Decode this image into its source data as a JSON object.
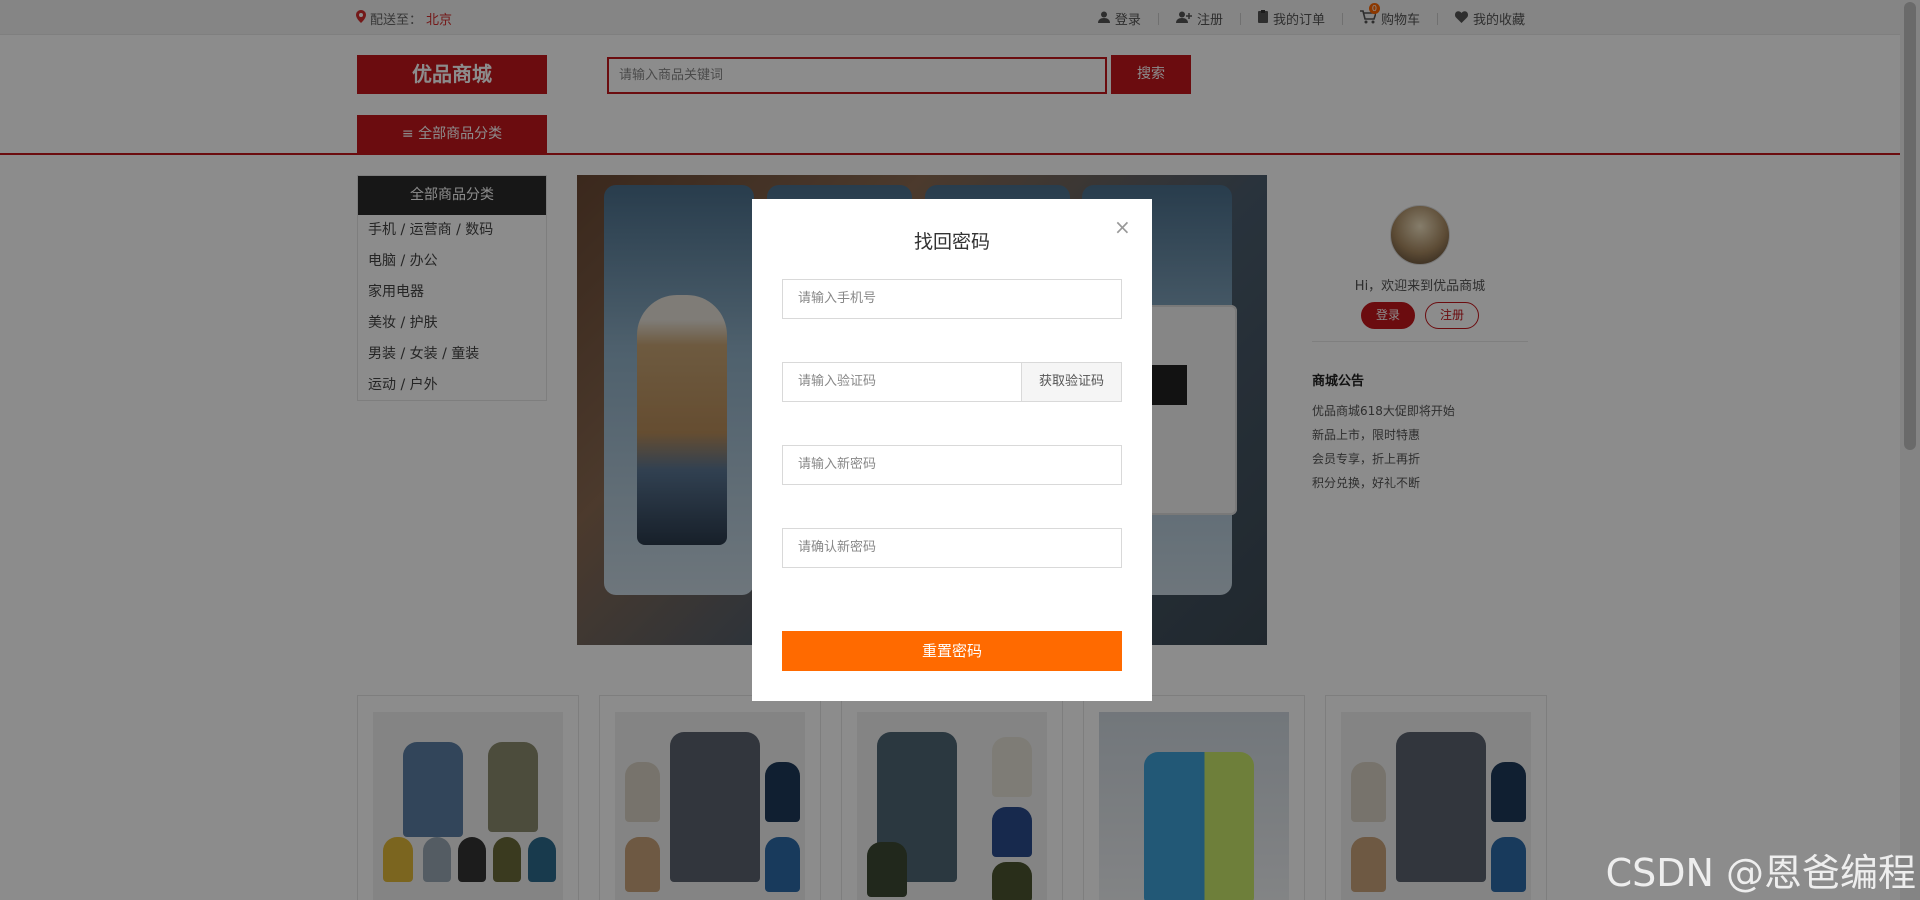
{
  "topbar": {
    "location_label": "配送至：",
    "city": "北京",
    "nav": {
      "login": "登录",
      "register": "注册",
      "orders": "我的订单",
      "cart": "购物车",
      "cart_count": "0",
      "favorites": "我的收藏"
    }
  },
  "header": {
    "logo": "优品商城",
    "search_placeholder": "请输入商品关键词",
    "search_button": "搜索",
    "all_categories_tab": "≡ 全部商品分类"
  },
  "categories": {
    "title": "全部商品分类",
    "rows": [
      "手机  /  运营商  /  数码",
      "电脑  /  办公",
      "家用电器",
      "美妆  /  护肤",
      "男装  /  女装  /  童装",
      "运动  /  户外"
    ]
  },
  "user_panel": {
    "welcome": "Hi，欢迎来到优品商城",
    "login": "登录",
    "register": "注册"
  },
  "notice": {
    "title": "商城公告",
    "items": [
      "优品商城618大促即将开始",
      "新品上市，限时特惠",
      "会员专享，折上再折",
      "积分兑换，好礼不断"
    ]
  },
  "modal": {
    "title": "找回密码",
    "close": "×",
    "phone_placeholder": "请输入手机号",
    "code_placeholder": "请输入验证码",
    "get_code": "获取验证码",
    "new_password_placeholder": "请输入新密码",
    "confirm_password_placeholder": "请确认新密码",
    "reset_button": "重置密码"
  },
  "watermark": "CSDN @恩爸编程",
  "colors": {
    "brand_red": "#c4161c",
    "accent_orange": "#ff6a00"
  }
}
